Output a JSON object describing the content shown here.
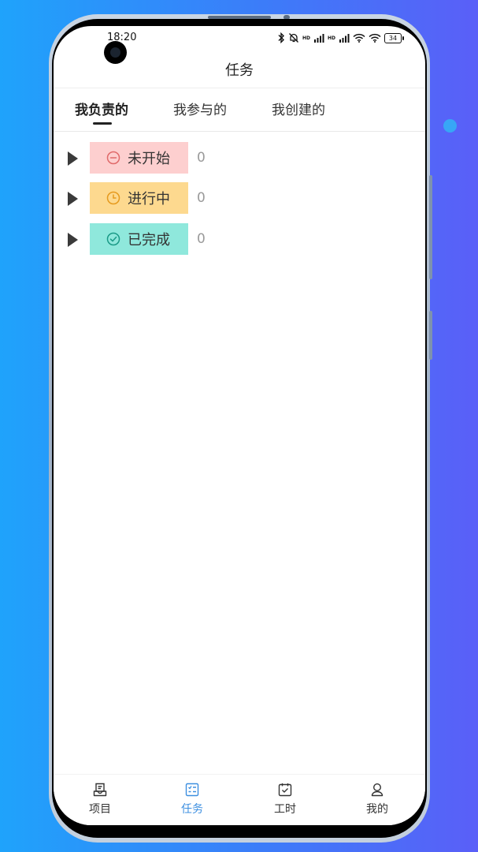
{
  "status_bar": {
    "time": "18:20",
    "hd_label": "HD",
    "battery": "34",
    "icons": [
      "bluetooth-icon",
      "bell-muted-icon",
      "signal-icon",
      "signal-icon",
      "wifi-icon",
      "wifi-icon",
      "battery-icon"
    ]
  },
  "header": {
    "title": "任务"
  },
  "tabs": [
    {
      "label": "我负责的",
      "active": true
    },
    {
      "label": "我参与的",
      "active": false
    },
    {
      "label": "我创建的",
      "active": false
    }
  ],
  "groups": [
    {
      "label": "未开始",
      "count": "0",
      "icon": "minus-circle-icon",
      "bg": "#fdcfcf",
      "icon_color": "#e06a6a"
    },
    {
      "label": "进行中",
      "count": "0",
      "icon": "clock-icon",
      "bg": "#fdd98f",
      "icon_color": "#e69a1e"
    },
    {
      "label": "已完成",
      "count": "0",
      "icon": "check-circle-icon",
      "bg": "#8fe8dc",
      "icon_color": "#1a9a87"
    }
  ],
  "bottom_nav": [
    {
      "label": "项目",
      "icon": "project-icon",
      "active": false
    },
    {
      "label": "任务",
      "icon": "task-icon",
      "active": true
    },
    {
      "label": "工时",
      "icon": "timesheet-icon",
      "active": false
    },
    {
      "label": "我的",
      "icon": "profile-icon",
      "active": false
    }
  ],
  "colors": {
    "accent": "#3d8fe0",
    "nav_inactive": "#333333"
  }
}
